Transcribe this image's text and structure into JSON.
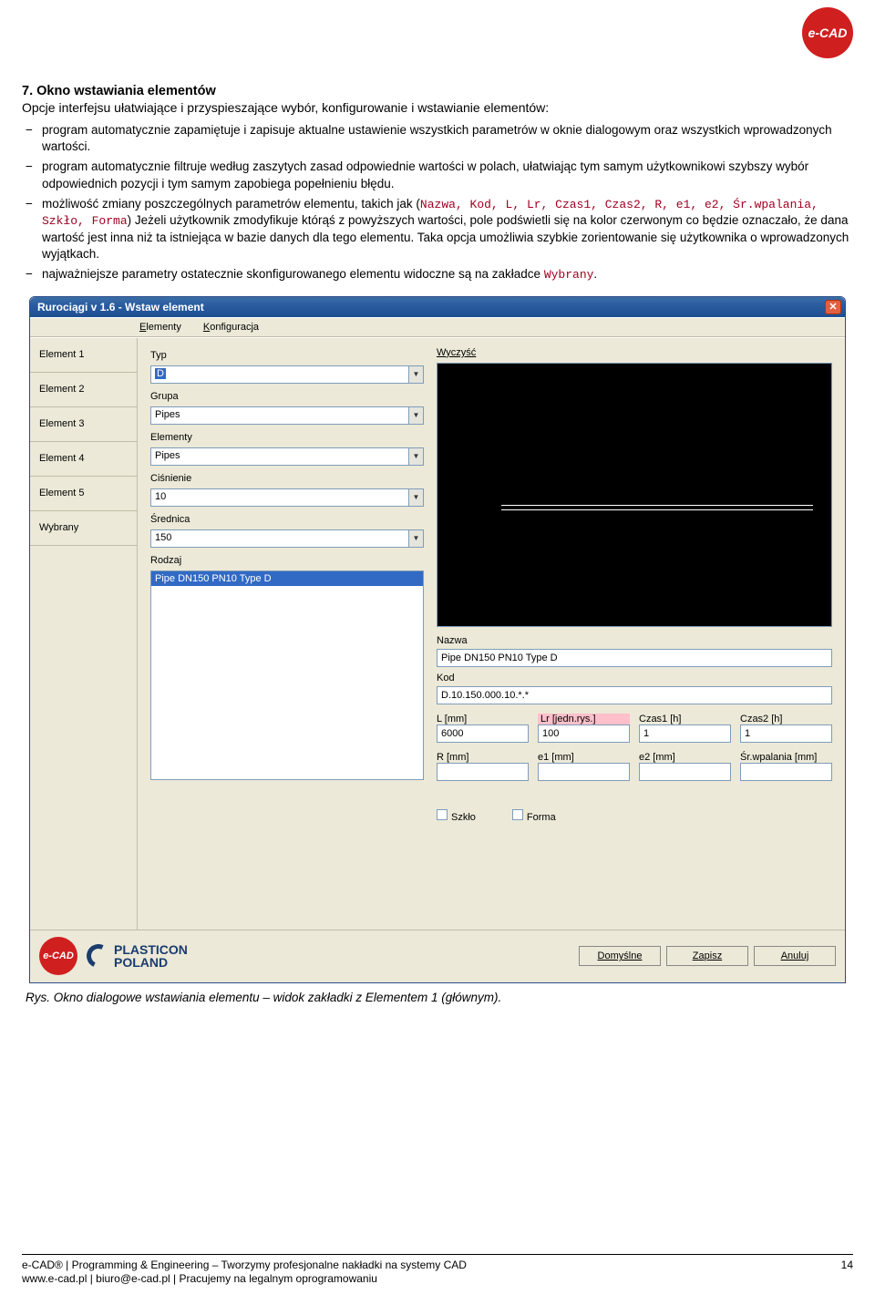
{
  "header": {
    "logo_text": "e-CAD"
  },
  "section": {
    "title": "7.   Okno wstawiania elementów",
    "subtitle": "Opcje interfejsu ułatwiające i przyspieszające wybór, konfigurowanie i wstawianie elementów:"
  },
  "bullets": {
    "b1": "program automatycznie zapamiętuje i zapisuje aktualne ustawienie wszystkich parametrów w oknie dialogowym oraz wszystkich wprowadzonych wartości.",
    "b2": "program automatycznie filtruje według zaszytych zasad odpowiednie wartości w polach, ułatwiając tym samym użytkownikowi szybszy wybór odpowiednich pozycji i tym samym zapobiega popełnieniu błędu.",
    "b3_pre": "możliwość zmiany poszczególnych parametrów elementu, takich jak (",
    "b3_code": "Nazwa, Kod, L, Lr, Czas1, Czas2, R, e1, e2, Śr.wpalania, Szkło, Forma",
    "b3_post": ") Jeżeli użytkownik zmodyfikuje którąś z powyższych wartości, pole podświetli się na kolor czerwonym co będzie oznaczało, że dana wartość jest inna niż ta istniejąca w bazie danych dla tego elementu. Taka opcja umożliwia szybkie zorientowanie się użytkownika o wprowadzonych wyjątkach.",
    "b4_pre": "najważniejsze parametry ostatecznie skonfigurowanego elementu widoczne są na zakładce ",
    "b4_code": "Wybrany",
    "b4_post": "."
  },
  "dialog": {
    "title": "Rurociągi v 1.6 - Wstaw element",
    "menus": {
      "elementy": "Elementy",
      "konfiguracja": "Konfiguracja"
    },
    "tabs": {
      "t1": "Element 1",
      "t2": "Element 2",
      "t3": "Element 3",
      "t4": "Element 4",
      "t5": "Element 5",
      "t6": "Wybrany"
    },
    "left": {
      "typ_label": "Typ",
      "typ_value": "D",
      "grupa_label": "Grupa",
      "grupa_value": "Pipes",
      "elementy_label": "Elementy",
      "elementy_value": "Pipes",
      "cisnienie_label": "Ciśnienie",
      "cisnienie_value": "10",
      "srednica_label": "Średnica",
      "srednica_value": "150",
      "rodzaj_label": "Rodzaj",
      "rodzaj_selected": "Pipe DN150 PN10 Type D"
    },
    "right": {
      "wyczysc": "Wyczyść",
      "nazwa_label": "Nazwa",
      "nazwa_value": "Pipe DN150 PN10 Type D",
      "kod_label": "Kod",
      "kod_value": "D.10.150.000.10.*.*",
      "row1": {
        "l_label": "L [mm]",
        "l_value": "6000",
        "lr_label": "Lr [jedn.rys.]",
        "lr_value": "100",
        "czas1_label": "Czas1 [h]",
        "czas1_value": "1",
        "czas2_label": "Czas2 [h]",
        "czas2_value": "1"
      },
      "row2": {
        "r_label": "R [mm]",
        "e1_label": "e1 [mm]",
        "e2_label": "e2 [mm]",
        "sr_label": "Śr.wpalania [mm]"
      },
      "szklo": "Szkło",
      "forma": "Forma"
    },
    "footer": {
      "domyslne": "Domyślne",
      "zapisz": "Zapisz",
      "anuluj": "Anuluj",
      "plasticon1": "PLASTICON",
      "plasticon2": "POLAND"
    }
  },
  "caption": "Rys. Okno dialogowe wstawiania elementu – widok zakładki z Elementem 1 (głównym).",
  "footer": {
    "line1": "e-CAD® | Programming & Engineering – Tworzymy profesjonalne nakładki na systemy CAD",
    "line2": "www.e-cad.pl | biuro@e-cad.pl | Pracujemy na legalnym oprogramowaniu",
    "page": "14"
  }
}
